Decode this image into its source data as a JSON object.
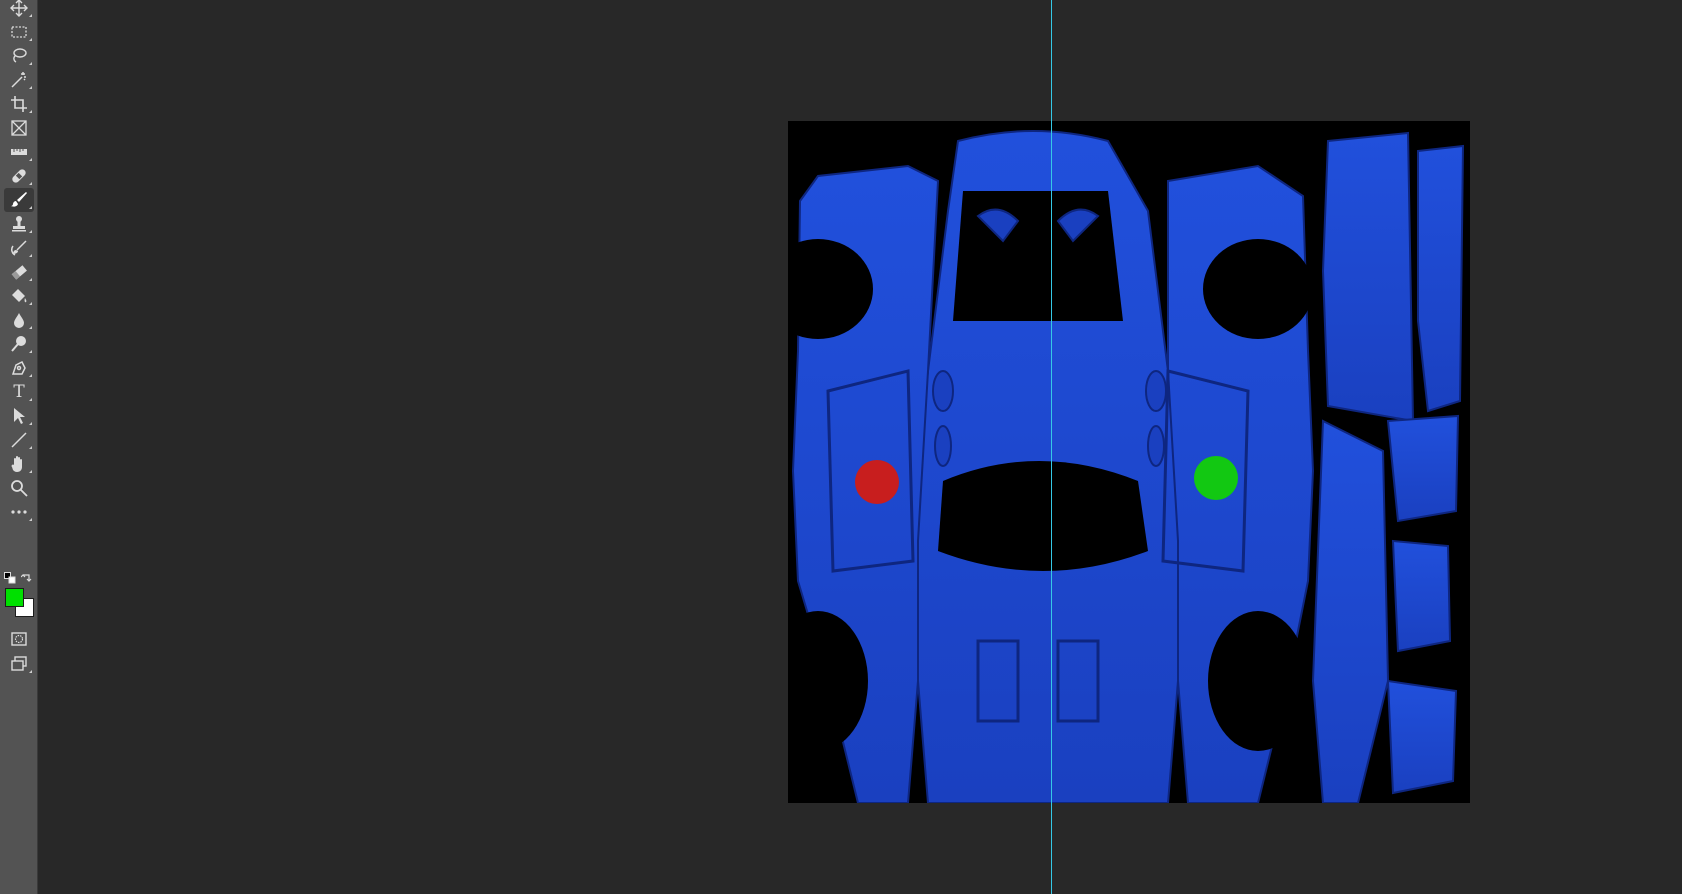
{
  "app": {
    "canvas_bg": "#282828",
    "toolbar_bg": "#535353",
    "guide_color": "#35c9e6"
  },
  "toolbar": {
    "tools": [
      {
        "name": "move-tool",
        "icon": "move-icon"
      },
      {
        "name": "rectangular-marquee-tool",
        "icon": "marquee-icon"
      },
      {
        "name": "lasso-tool",
        "icon": "lasso-icon"
      },
      {
        "name": "magic-wand-tool",
        "icon": "magic-wand-icon"
      },
      {
        "name": "crop-tool",
        "icon": "crop-icon"
      },
      {
        "name": "frame-tool",
        "icon": "frame-icon"
      },
      {
        "name": "ruler-tool",
        "icon": "ruler-icon"
      },
      {
        "name": "healing-brush-tool",
        "icon": "bandage-icon"
      },
      {
        "name": "brush-tool",
        "icon": "brush-icon",
        "active": true
      },
      {
        "name": "clone-stamp-tool",
        "icon": "stamp-icon"
      },
      {
        "name": "history-brush-tool",
        "icon": "history-brush-icon"
      },
      {
        "name": "eraser-tool",
        "icon": "eraser-icon"
      },
      {
        "name": "paint-bucket-tool",
        "icon": "paint-bucket-icon"
      },
      {
        "name": "blur-tool",
        "icon": "drop-icon"
      },
      {
        "name": "dodge-tool",
        "icon": "dodge-icon"
      },
      {
        "name": "pen-tool",
        "icon": "pen-icon"
      },
      {
        "name": "type-tool",
        "icon": "type-icon",
        "label": "T"
      },
      {
        "name": "path-selection-tool",
        "icon": "arrow-icon"
      },
      {
        "name": "line-tool",
        "icon": "line-icon"
      },
      {
        "name": "hand-tool",
        "icon": "hand-icon"
      },
      {
        "name": "zoom-tool",
        "icon": "zoom-icon"
      },
      {
        "name": "edit-toolbar",
        "icon": "more-icon"
      }
    ],
    "foreground_color": "#00e000",
    "background_color": "#ffffff"
  },
  "document": {
    "image": "car-uv-texture-map",
    "base_color": "#1f4fd8",
    "markers": [
      {
        "name": "red-marker",
        "color": "#c81e1e"
      },
      {
        "name": "green-marker",
        "color": "#12c812"
      }
    ]
  }
}
